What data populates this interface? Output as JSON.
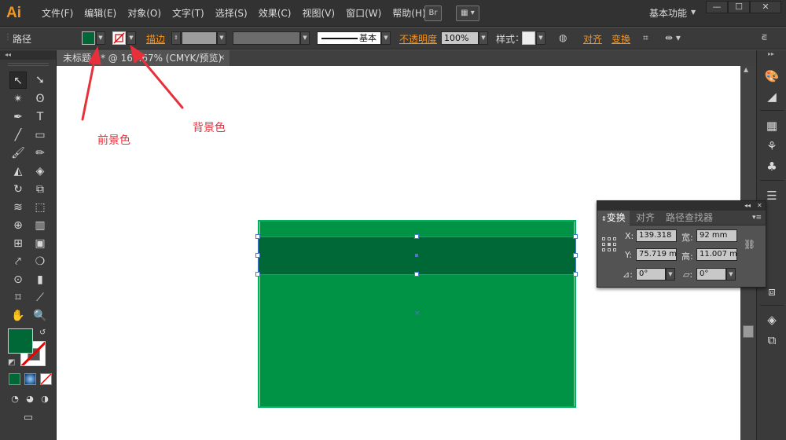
{
  "app": {
    "logo": "Ai",
    "menu": [
      "文件(F)",
      "编辑(E)",
      "对象(O)",
      "文字(T)",
      "选择(S)",
      "效果(C)",
      "视图(V)",
      "窗口(W)",
      "帮助(H)"
    ],
    "bridge_icon": "Br",
    "workspace": "基本功能",
    "window_controls": [
      "—",
      "☐",
      "✕"
    ]
  },
  "control_bar": {
    "object_type": "路径",
    "stroke_link": "描边",
    "stroke_style": "基本",
    "opacity_link": "不透明度",
    "opacity_value": "100%",
    "style_label": "样式",
    "align_link": "对齐",
    "transform_link": "变换",
    "fill_color": "#006837"
  },
  "document": {
    "tab_title": "未标题-1* @ 166.67% (CMYK/预览)",
    "close": "×"
  },
  "artwork": {
    "artboard_color": "#009245",
    "selected_color": "#006837",
    "selection_color": "#4a7ac7"
  },
  "transform_panel": {
    "tabs": [
      "变换",
      "对齐",
      "路径查找器"
    ],
    "x_label": "X:",
    "x_value": "139.318",
    "width_label": "宽:",
    "width_value": "92 mm",
    "y_label": "Y:",
    "y_value": "75.719 m",
    "height_label": "高:",
    "height_value": "11.007 m",
    "rotate_value": "0°",
    "shear_value": "0°"
  },
  "annotations": {
    "foreground": "前景色",
    "background": "背景色",
    "color": "#e8303a"
  }
}
